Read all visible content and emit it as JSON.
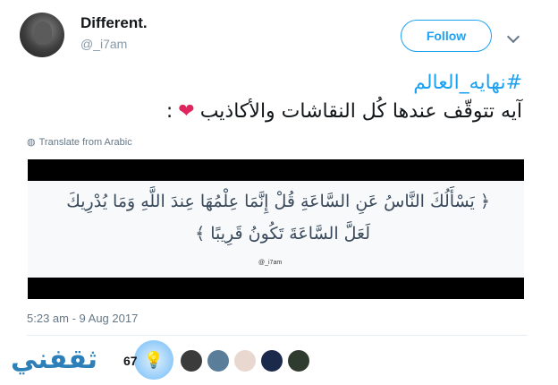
{
  "header": {
    "display_name": "Different.",
    "handle": "@_i7am",
    "follow_label": "Follow"
  },
  "tweet": {
    "hashtag": "#نهايه_العالم",
    "text": "آيه تتوقّف عندها كُل النقاشات والأكاذيب",
    "trailing": ":",
    "translate_label": "Translate from Arabic"
  },
  "media": {
    "verse_line1": "﴿ يَسْأَلُكَ النَّاسُ عَنِ السَّاعَةِ قُلْ إِنَّمَا عِلْمُهَا عِندَ اللَّهِ وَمَا يُدْرِيكَ",
    "verse_line2": "لَعَلَّ السَّاعَةَ تَكُونُ قَرِيبًا ﴾",
    "watermark": "@_i7am"
  },
  "meta": {
    "timestamp": "5:23 am - 9 Aug 2017",
    "count": "67"
  },
  "likers": [
    "#3b3b3b",
    "#5a7d9a",
    "#e8d8d0",
    "#1b2a4a",
    "#2f3b2f"
  ],
  "watermark_logo": {
    "text": "ثقفني"
  },
  "icons": {
    "avatar": "avatar",
    "chevron": "chevron-down-icon",
    "globe": "globe-icon",
    "heart": "heart-icon",
    "bulb": "lightbulb-icon"
  },
  "colors": {
    "accent": "#1da1f2",
    "heart": "#e0245e",
    "muted": "#657786",
    "logo": "#2c7fb8"
  }
}
